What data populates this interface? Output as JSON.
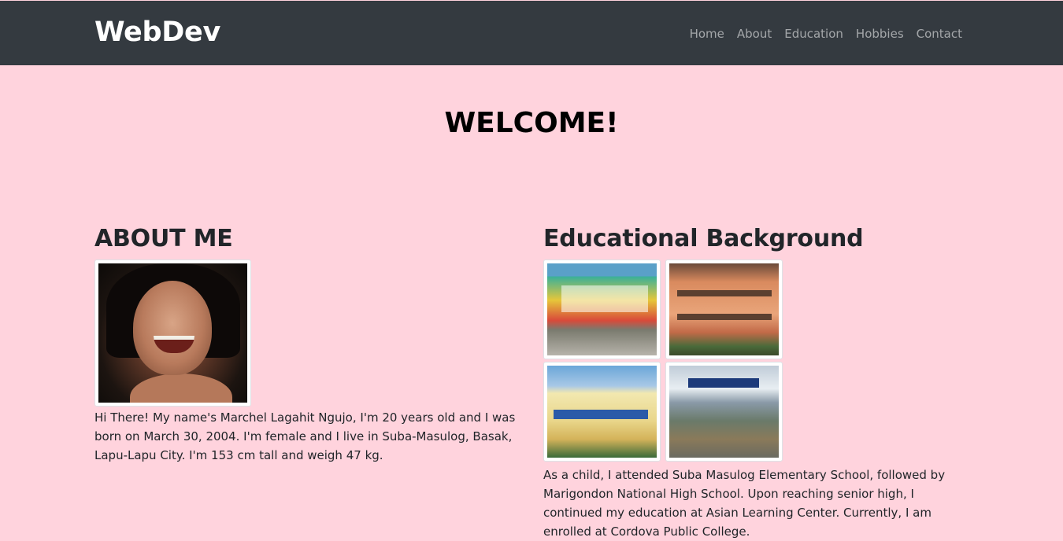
{
  "navbar": {
    "brand": "WebDev",
    "links": [
      "Home",
      "About",
      "Education",
      "Hobbies",
      "Contact"
    ]
  },
  "welcome": "WELCOME!",
  "about": {
    "heading": "ABOUT ME",
    "text": "Hi There! My name's Marchel Lagahit Ngujo, I'm 20 years old and I was born on March 30, 2004. I'm female and I live in Suba-Masulog, Basak, Lapu-Lapu City. I'm 153 cm tall and weigh 47 kg."
  },
  "education": {
    "heading": "Educational Background",
    "text": "As a child, I attended Suba Masulog Elementary School, followed by Marigondon National High School. Upon reaching senior high, I continued my education at Asian Learning Center. Currently, I am enrolled at Cordova Public College."
  }
}
